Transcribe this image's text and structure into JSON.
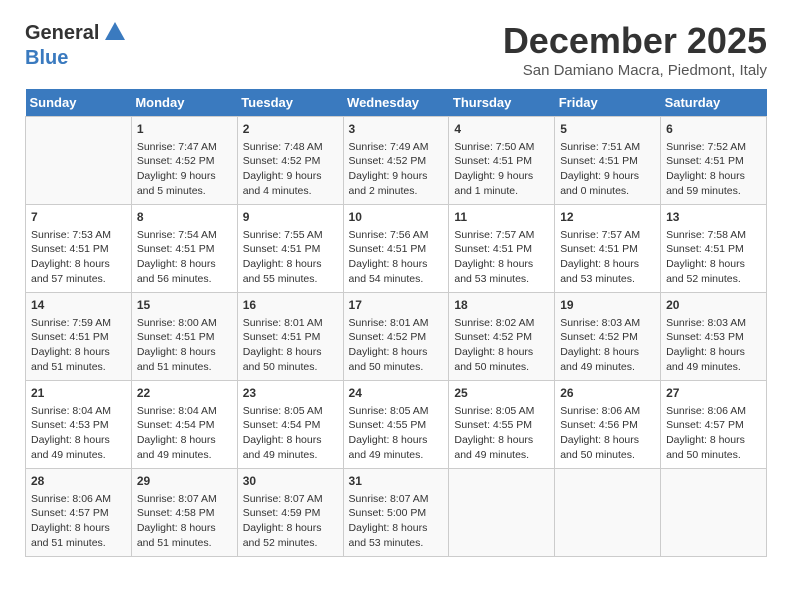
{
  "header": {
    "logo_general": "General",
    "logo_blue": "Blue",
    "month_title": "December 2025",
    "location": "San Damiano Macra, Piedmont, Italy"
  },
  "days_of_week": [
    "Sunday",
    "Monday",
    "Tuesday",
    "Wednesday",
    "Thursday",
    "Friday",
    "Saturday"
  ],
  "weeks": [
    [
      {
        "day": "",
        "info": ""
      },
      {
        "day": "1",
        "info": "Sunrise: 7:47 AM\nSunset: 4:52 PM\nDaylight: 9 hours\nand 5 minutes."
      },
      {
        "day": "2",
        "info": "Sunrise: 7:48 AM\nSunset: 4:52 PM\nDaylight: 9 hours\nand 4 minutes."
      },
      {
        "day": "3",
        "info": "Sunrise: 7:49 AM\nSunset: 4:52 PM\nDaylight: 9 hours\nand 2 minutes."
      },
      {
        "day": "4",
        "info": "Sunrise: 7:50 AM\nSunset: 4:51 PM\nDaylight: 9 hours\nand 1 minute."
      },
      {
        "day": "5",
        "info": "Sunrise: 7:51 AM\nSunset: 4:51 PM\nDaylight: 9 hours\nand 0 minutes."
      },
      {
        "day": "6",
        "info": "Sunrise: 7:52 AM\nSunset: 4:51 PM\nDaylight: 8 hours\nand 59 minutes."
      }
    ],
    [
      {
        "day": "7",
        "info": "Sunrise: 7:53 AM\nSunset: 4:51 PM\nDaylight: 8 hours\nand 57 minutes."
      },
      {
        "day": "8",
        "info": "Sunrise: 7:54 AM\nSunset: 4:51 PM\nDaylight: 8 hours\nand 56 minutes."
      },
      {
        "day": "9",
        "info": "Sunrise: 7:55 AM\nSunset: 4:51 PM\nDaylight: 8 hours\nand 55 minutes."
      },
      {
        "day": "10",
        "info": "Sunrise: 7:56 AM\nSunset: 4:51 PM\nDaylight: 8 hours\nand 54 minutes."
      },
      {
        "day": "11",
        "info": "Sunrise: 7:57 AM\nSunset: 4:51 PM\nDaylight: 8 hours\nand 53 minutes."
      },
      {
        "day": "12",
        "info": "Sunrise: 7:57 AM\nSunset: 4:51 PM\nDaylight: 8 hours\nand 53 minutes."
      },
      {
        "day": "13",
        "info": "Sunrise: 7:58 AM\nSunset: 4:51 PM\nDaylight: 8 hours\nand 52 minutes."
      }
    ],
    [
      {
        "day": "14",
        "info": "Sunrise: 7:59 AM\nSunset: 4:51 PM\nDaylight: 8 hours\nand 51 minutes."
      },
      {
        "day": "15",
        "info": "Sunrise: 8:00 AM\nSunset: 4:51 PM\nDaylight: 8 hours\nand 51 minutes."
      },
      {
        "day": "16",
        "info": "Sunrise: 8:01 AM\nSunset: 4:51 PM\nDaylight: 8 hours\nand 50 minutes."
      },
      {
        "day": "17",
        "info": "Sunrise: 8:01 AM\nSunset: 4:52 PM\nDaylight: 8 hours\nand 50 minutes."
      },
      {
        "day": "18",
        "info": "Sunrise: 8:02 AM\nSunset: 4:52 PM\nDaylight: 8 hours\nand 50 minutes."
      },
      {
        "day": "19",
        "info": "Sunrise: 8:03 AM\nSunset: 4:52 PM\nDaylight: 8 hours\nand 49 minutes."
      },
      {
        "day": "20",
        "info": "Sunrise: 8:03 AM\nSunset: 4:53 PM\nDaylight: 8 hours\nand 49 minutes."
      }
    ],
    [
      {
        "day": "21",
        "info": "Sunrise: 8:04 AM\nSunset: 4:53 PM\nDaylight: 8 hours\nand 49 minutes."
      },
      {
        "day": "22",
        "info": "Sunrise: 8:04 AM\nSunset: 4:54 PM\nDaylight: 8 hours\nand 49 minutes."
      },
      {
        "day": "23",
        "info": "Sunrise: 8:05 AM\nSunset: 4:54 PM\nDaylight: 8 hours\nand 49 minutes."
      },
      {
        "day": "24",
        "info": "Sunrise: 8:05 AM\nSunset: 4:55 PM\nDaylight: 8 hours\nand 49 minutes."
      },
      {
        "day": "25",
        "info": "Sunrise: 8:05 AM\nSunset: 4:55 PM\nDaylight: 8 hours\nand 49 minutes."
      },
      {
        "day": "26",
        "info": "Sunrise: 8:06 AM\nSunset: 4:56 PM\nDaylight: 8 hours\nand 50 minutes."
      },
      {
        "day": "27",
        "info": "Sunrise: 8:06 AM\nSunset: 4:57 PM\nDaylight: 8 hours\nand 50 minutes."
      }
    ],
    [
      {
        "day": "28",
        "info": "Sunrise: 8:06 AM\nSunset: 4:57 PM\nDaylight: 8 hours\nand 51 minutes."
      },
      {
        "day": "29",
        "info": "Sunrise: 8:07 AM\nSunset: 4:58 PM\nDaylight: 8 hours\nand 51 minutes."
      },
      {
        "day": "30",
        "info": "Sunrise: 8:07 AM\nSunset: 4:59 PM\nDaylight: 8 hours\nand 52 minutes."
      },
      {
        "day": "31",
        "info": "Sunrise: 8:07 AM\nSunset: 5:00 PM\nDaylight: 8 hours\nand 53 minutes."
      },
      {
        "day": "",
        "info": ""
      },
      {
        "day": "",
        "info": ""
      },
      {
        "day": "",
        "info": ""
      }
    ]
  ]
}
